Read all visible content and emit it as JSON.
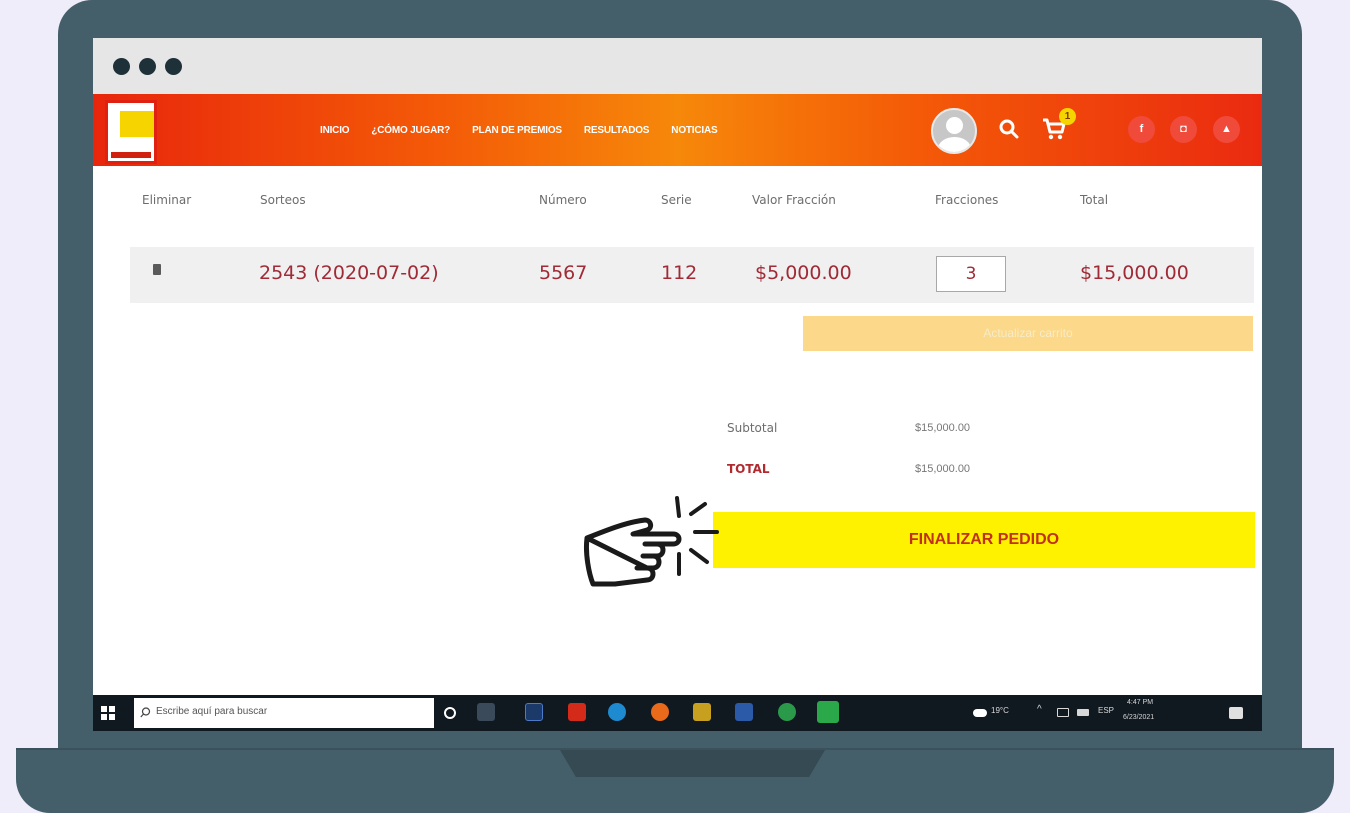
{
  "window": {
    "controls": [
      "dot",
      "dot",
      "dot"
    ]
  },
  "nav": {
    "links": [
      "INICIO",
      "¿CÓMO JUGAR?",
      "PLAN DE PREMIOS",
      "RESULTADOS",
      "NOTICIAS"
    ],
    "cart_count": "1",
    "social": [
      "f",
      "◘",
      "▲"
    ]
  },
  "cart": {
    "headers": {
      "eliminar": "Eliminar",
      "sorteos": "Sorteos",
      "numero": "Número",
      "serie": "Serie",
      "valor": "Valor Fracción",
      "fracciones": "Fracciones",
      "total": "Total"
    },
    "row": {
      "sorteo": "2543 (2020-07-02)",
      "numero": "5567",
      "serie": "112",
      "valor": "$5,000.00",
      "fracciones": "3",
      "total": "$15,000.00"
    },
    "update_label": "Actualizar carrito"
  },
  "summary": {
    "subtotal_label": "Subtotal",
    "subtotal_value": "$15,000.00",
    "total_label": "TOTAL",
    "total_value": "$15,000.00"
  },
  "finalize_label": "FINALIZAR PEDIDO",
  "taskbar": {
    "search_placeholder": "Escribe aquí para buscar",
    "weather": "19°C",
    "lang": "ESP",
    "time": "4:47 PM",
    "date": "6/23/2021"
  },
  "colors": {
    "nav_gradient": [
      "#e8260c",
      "#f6880a"
    ],
    "cart_text": "#a02a36",
    "finalize_bg": "#fff200",
    "update_bg": "#fbd88a"
  }
}
